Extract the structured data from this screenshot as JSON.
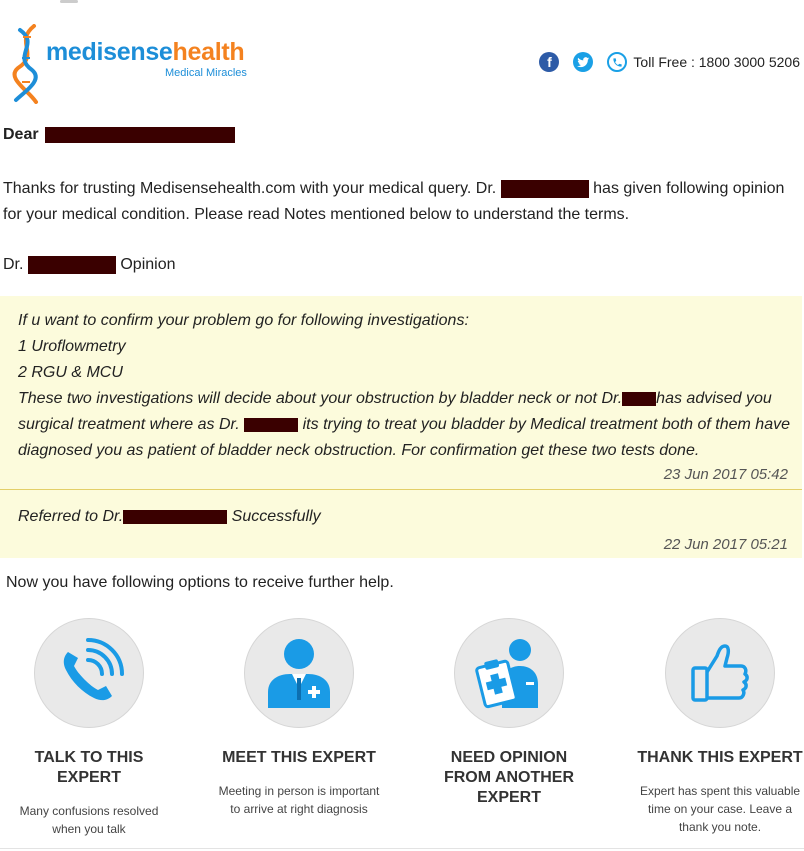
{
  "brand": {
    "name_part1": "medisense",
    "name_part2": "health",
    "tagline": "Medical Miracles"
  },
  "header": {
    "facebook_icon": "facebook-icon",
    "twitter_icon": "twitter-icon",
    "phone_icon": "phone-icon",
    "toll_free": "Toll Free : 1800 3000 5206"
  },
  "greeting": {
    "salutation": "Dear"
  },
  "intro": {
    "text1": "Thanks for trusting Medisensehealth.com with your medical query. Dr.",
    "text2": "has given following opinion for your medical condition. Please read Notes mentioned below to understand the terms."
  },
  "opinion_heading": {
    "prefix": "Dr.",
    "suffix": "Opinion"
  },
  "opinion": {
    "lines": [
      "If u want to confirm your problem go for following investigations:",
      "1 Uroflowmetry",
      "2 RGU & MCU"
    ],
    "para_part1": "These two investigations will decide about your obstruction by bladder neck or not Dr.",
    "para_part2": "has advised you surgical treatment where as Dr.",
    "para_part3": "its trying to treat you bladder by Medical treatment both of them have diagnosed you as patient of bladder neck obstruction. For confirmation get these two tests done.",
    "timestamp": "23 Jun 2017 05:42"
  },
  "referral": {
    "prefix": "Referred to Dr.",
    "suffix": "Successfully",
    "timestamp": "22 Jun 2017 05:21"
  },
  "options_intro": "Now you have following options to receive further help.",
  "options": [
    {
      "icon": "phone-call-icon",
      "title_line1": "TALK TO THIS",
      "title_line2": "EXPERT",
      "desc_line1": "Many confusions resolved",
      "desc_line2": "when you talk"
    },
    {
      "icon": "doctor-icon",
      "title_line1": "MEET THIS EXPERT",
      "desc_line1": "Meeting in person is important",
      "desc_line2": "to arrive at right diagnosis"
    },
    {
      "icon": "second-opinion-icon",
      "title_line1": "NEED OPINION",
      "title_line2": "FROM ANOTHER",
      "title_line3": "EXPERT"
    },
    {
      "icon": "thumbs-up-icon",
      "title_line1": "THANK THIS EXPERT",
      "desc_line1": "Expert has spent this valuable",
      "desc_line2": "time on your case. Leave a",
      "desc_line3": "thank you note."
    }
  ],
  "colors": {
    "brand_blue": "#1d8ed8",
    "brand_orange": "#f4821f",
    "panel_bg": "#fcfbdc",
    "icon_blue": "#1a9be6"
  }
}
